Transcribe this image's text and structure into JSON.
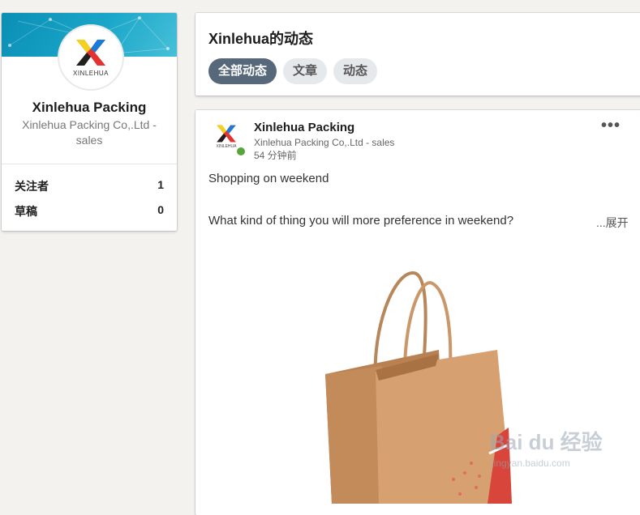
{
  "profile": {
    "logo_text": "XINLEHUA",
    "name": "Xinlehua Packing",
    "subtitle": "Xinlehua Packing Co,.Ltd - sales",
    "stats": [
      {
        "label": "关注者",
        "value": "1"
      },
      {
        "label": "草稿",
        "value": "0"
      }
    ]
  },
  "feed_header": {
    "title": "Xinlehua的动态",
    "tabs": [
      {
        "label": "全部动态",
        "active": true
      },
      {
        "label": "文章",
        "active": false
      },
      {
        "label": "动态",
        "active": false
      }
    ]
  },
  "post": {
    "logo_text": "XINLEHUA",
    "author": "Xinlehua Packing",
    "author_subtitle": "Xinlehua Packing Co,.Ltd - sales",
    "time": "54 分钟前",
    "more_icon": "ellipsis-icon",
    "text_line1": "Shopping on weekend",
    "text_line2": "What kind of thing you will more preference in weekend?",
    "expand_label": "...展开",
    "image": "kraft-paper-shopping-bag",
    "watermark_main": "Bai du 经验",
    "watermark_sub": "jingyan.baidu.com"
  },
  "colors": {
    "banner": "#0a8fb4",
    "tab_active": "#56687a",
    "tab_inactive": "#e6e9ec",
    "online": "#57a639",
    "kraft": "#c9915c"
  }
}
